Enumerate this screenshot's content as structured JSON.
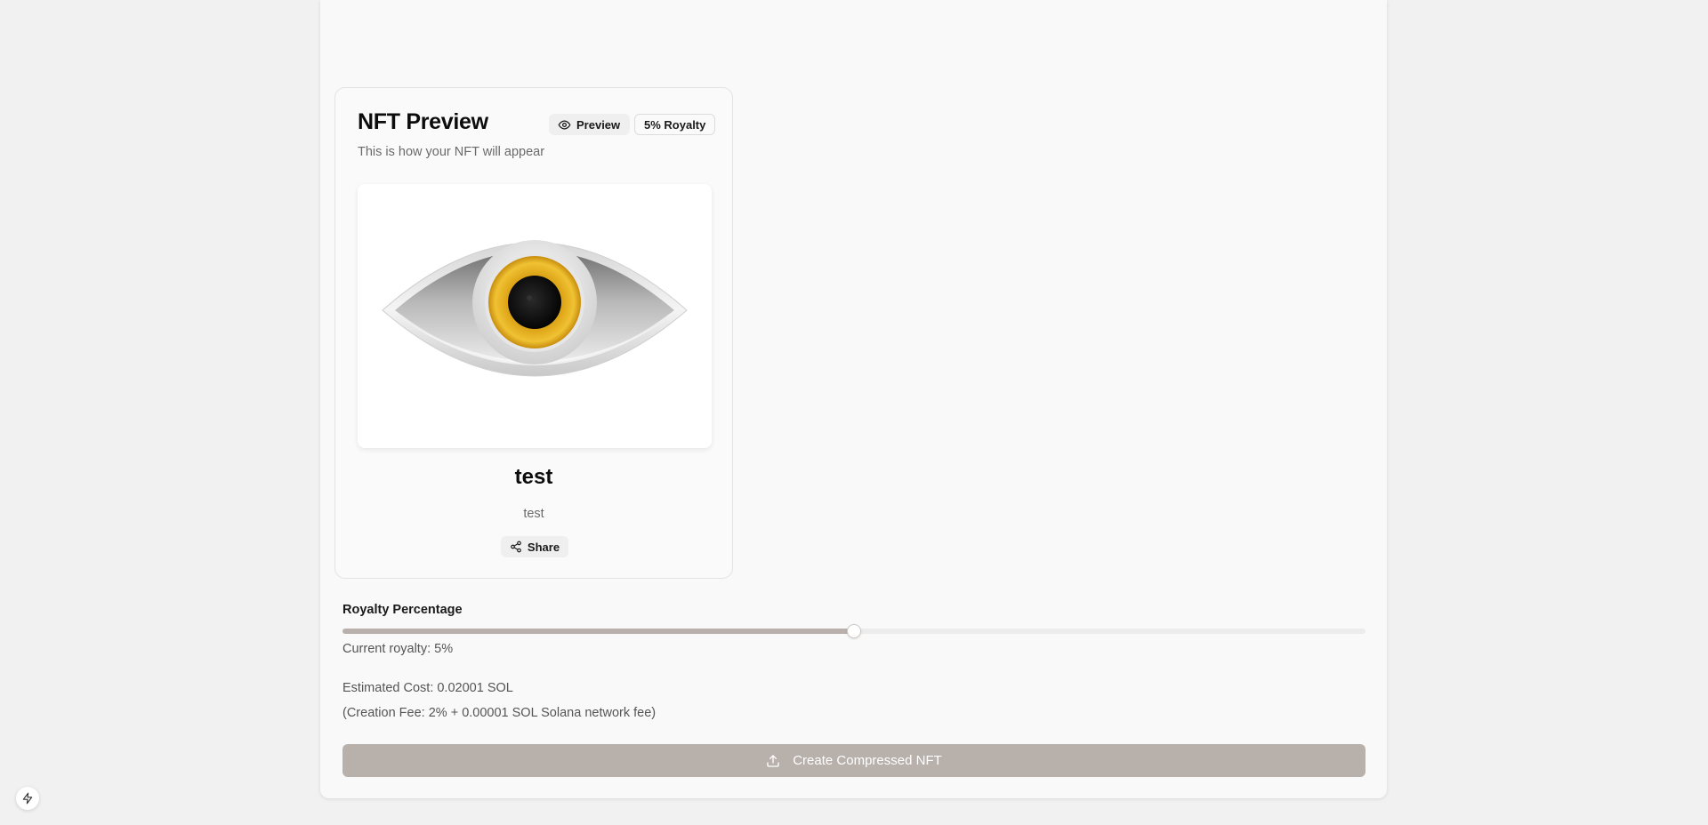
{
  "preview_card": {
    "title": "NFT Preview",
    "description": "This is how your NFT will appear",
    "preview_badge": "Preview",
    "royalty_badge": "5% Royalty",
    "nft_name": "test",
    "nft_description": "test",
    "share_label": "Share",
    "image_icon": "eye-image"
  },
  "royalty": {
    "label": "Royalty Percentage",
    "current_text": "Current royalty: 5%",
    "slider_fraction": 0.5
  },
  "cost": {
    "estimated": "Estimated Cost: 0.02001 SOL",
    "fee_note": "(Creation Fee: 2% + 0.00001 SOL Solana network fee)"
  },
  "create_button": {
    "label": "Create Compressed NFT",
    "icon": "upload-icon"
  },
  "colors": {
    "accent_disabled": "#b8b0ab",
    "iris": "#e8b21a"
  }
}
